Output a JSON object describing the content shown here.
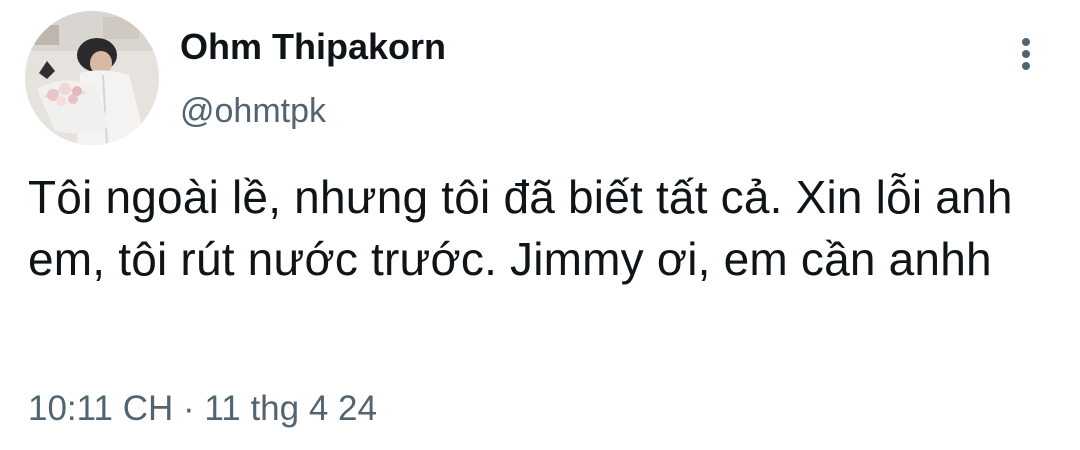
{
  "author": {
    "display_name": "Ohm Thipakorn",
    "handle": "@ohmtpk",
    "avatar_icon": "profile-photo"
  },
  "menu": {
    "icon": "more-vertical-icon"
  },
  "tweet": {
    "text": "Tôi ngoài lề, nhưng tôi đã biết tất cả. Xin lỗi anh em, tôi rút nước trước. Jimmy ơi, em cần anhh"
  },
  "meta": {
    "time": "10:11 CH",
    "separator": "·",
    "date": "11 thg 4 24"
  },
  "colors": {
    "primary_text": "#0f1419",
    "secondary_text": "#536471",
    "background": "#ffffff"
  }
}
